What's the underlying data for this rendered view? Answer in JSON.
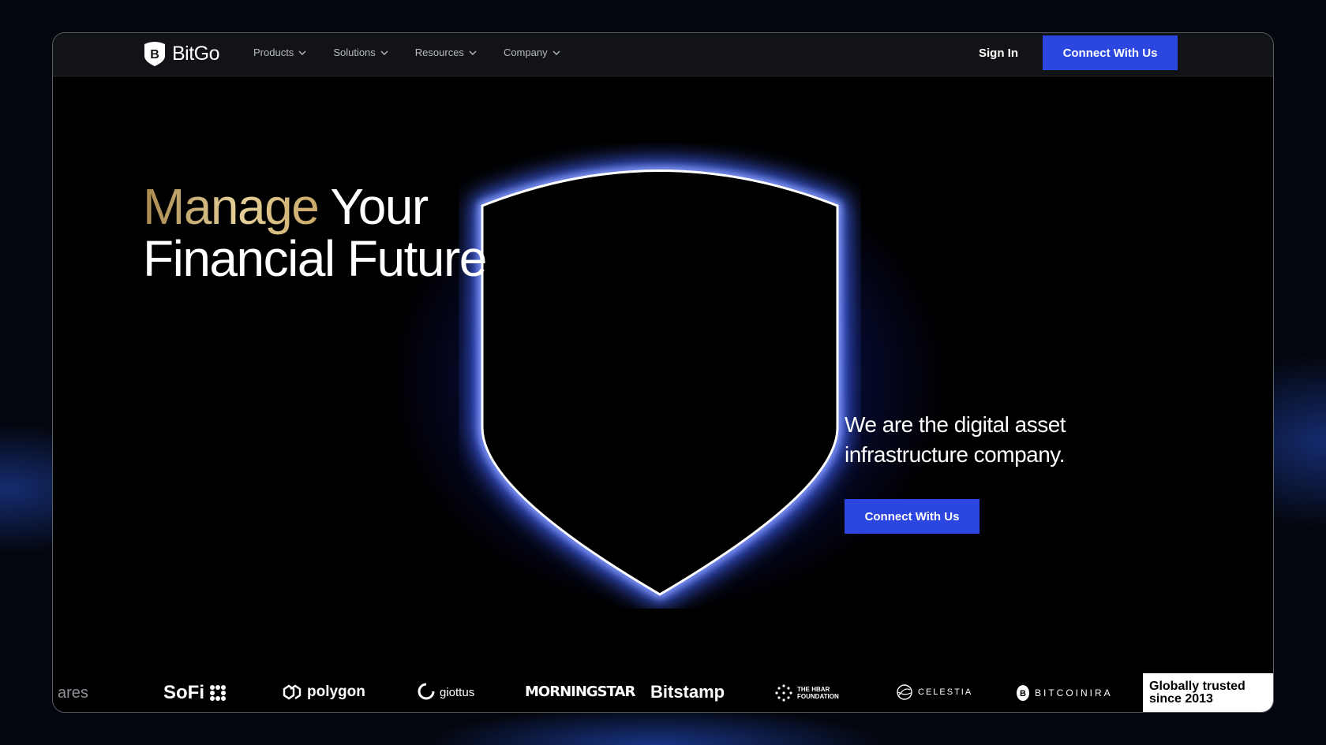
{
  "brand": {
    "name": "BitGo"
  },
  "nav": {
    "menu": [
      {
        "label": "Products"
      },
      {
        "label": "Solutions"
      },
      {
        "label": "Resources"
      },
      {
        "label": "Company"
      }
    ],
    "sign_in": "Sign In",
    "cta": "Connect With Us"
  },
  "hero": {
    "headline_accent": "Manage",
    "headline_rest": "Your",
    "headline_line2": "Financial Future",
    "tagline": "We are the digital asset infrastructure company.",
    "cta": "Connect With Us"
  },
  "partners": [
    "ares",
    "SoFi",
    "polygon",
    "giottus",
    "MORNINGSTAR",
    "Bitstamp",
    "THE HBAR FOUNDATION",
    "CELESTIA",
    "BITCOINIRA"
  ],
  "badge": {
    "line1": "Globally trusted",
    "line2": "since 2013"
  },
  "colors": {
    "accent": "#2b47e0",
    "glow": "#3c5bff",
    "gold": "#d8c08a",
    "background": "#000000"
  }
}
